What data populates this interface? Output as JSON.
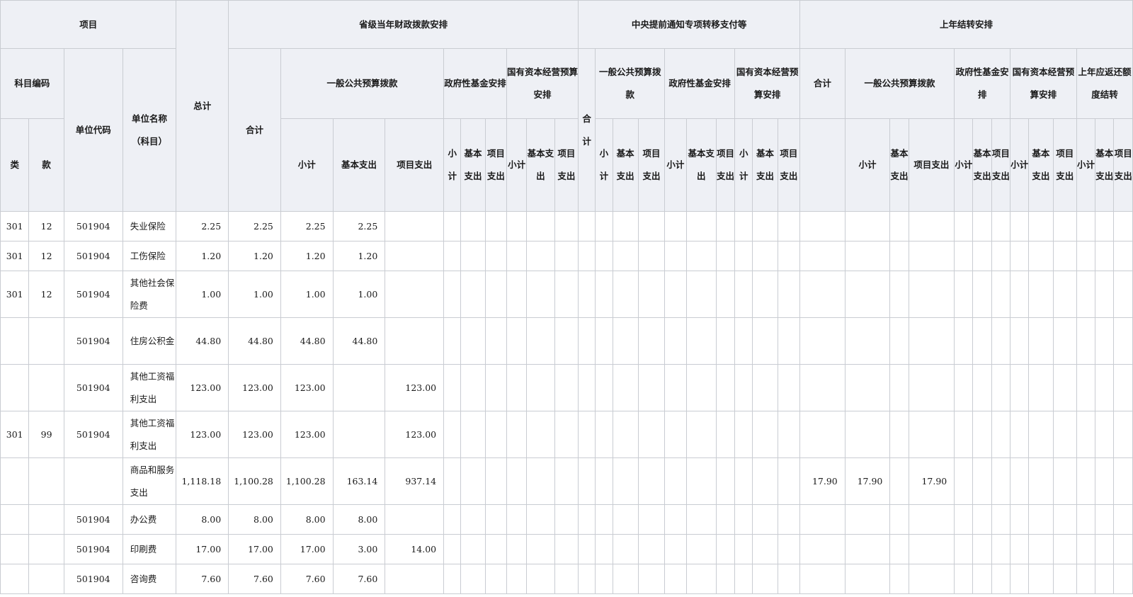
{
  "header": {
    "project": "项目",
    "subject_code": "科目编码",
    "category": "类",
    "section": "款",
    "unit_code": "单位代码",
    "unit_name": "单位名称（科目）",
    "grand_total": "总计",
    "provincial": "省级当年财政拨款安排",
    "central": "中央提前通知专项转移支付等",
    "carryover": "上年结转安排",
    "total": "合计",
    "general_budget": "一般公共预算拨款",
    "gov_fund": "政府性基金安排",
    "state_capital": "国有资本经营预算安排",
    "general_budget_central": "一般公共预算拨款",
    "gov_fund_central": "政府性基金安排",
    "state_capital_central": "国有资本经营预算安排",
    "total_carry": "合计",
    "general_budget_carry": "一般公共预算拨款",
    "gov_fund_carry": "政府性基金安排",
    "state_capital_carry": "国有资本经营预算安排",
    "prev_refund": "上年应返还额度结转",
    "subtotal": "小计",
    "basic": "基本支出",
    "project_exp": "项目支出"
  },
  "rows": [
    {
      "cat": "301",
      "sec": "12",
      "unit": "501904",
      "name": "失业保险",
      "total": "2.25",
      "p_total": "2.25",
      "p_sub": "2.25",
      "p_basic": "2.25",
      "p_proj": "",
      "c_total": "",
      "c_sub": "",
      "c_proj": ""
    },
    {
      "cat": "301",
      "sec": "12",
      "unit": "501904",
      "name": "工伤保险",
      "total": "1.20",
      "p_total": "1.20",
      "p_sub": "1.20",
      "p_basic": "1.20",
      "p_proj": "",
      "c_total": "",
      "c_sub": "",
      "c_proj": ""
    },
    {
      "cat": "301",
      "sec": "12",
      "unit": "501904",
      "name": "其他社会保险费",
      "total": "1.00",
      "p_total": "1.00",
      "p_sub": "1.00",
      "p_basic": "1.00",
      "p_proj": "",
      "c_total": "",
      "c_sub": "",
      "c_proj": ""
    },
    {
      "cat": "",
      "sec": "",
      "unit": "501904",
      "name": "住房公积金",
      "total": "44.80",
      "p_total": "44.80",
      "p_sub": "44.80",
      "p_basic": "44.80",
      "p_proj": "",
      "c_total": "",
      "c_sub": "",
      "c_proj": ""
    },
    {
      "cat": "",
      "sec": "",
      "unit": "501904",
      "name": "其他工资福利支出",
      "total": "123.00",
      "p_total": "123.00",
      "p_sub": "123.00",
      "p_basic": "",
      "p_proj": "123.00",
      "c_total": "",
      "c_sub": "",
      "c_proj": ""
    },
    {
      "cat": "301",
      "sec": "99",
      "unit": "501904",
      "name": "其他工资福利支出",
      "total": "123.00",
      "p_total": "123.00",
      "p_sub": "123.00",
      "p_basic": "",
      "p_proj": "123.00",
      "c_total": "",
      "c_sub": "",
      "c_proj": ""
    },
    {
      "cat": "",
      "sec": "",
      "unit": "",
      "name": "商品和服务支出",
      "total": "1,118.18",
      "p_total": "1,100.28",
      "p_sub": "1,100.28",
      "p_basic": "163.14",
      "p_proj": "937.14",
      "c_total": "17.90",
      "c_sub": "17.90",
      "c_proj": "17.90"
    },
    {
      "cat": "",
      "sec": "",
      "unit": "501904",
      "name": "办公费",
      "total": "8.00",
      "p_total": "8.00",
      "p_sub": "8.00",
      "p_basic": "8.00",
      "p_proj": "",
      "c_total": "",
      "c_sub": "",
      "c_proj": ""
    },
    {
      "cat": "",
      "sec": "",
      "unit": "501904",
      "name": "印刷费",
      "total": "17.00",
      "p_total": "17.00",
      "p_sub": "17.00",
      "p_basic": "3.00",
      "p_proj": "14.00",
      "c_total": "",
      "c_sub": "",
      "c_proj": ""
    },
    {
      "cat": "",
      "sec": "",
      "unit": "501904",
      "name": "咨询费",
      "total": "7.60",
      "p_total": "7.60",
      "p_sub": "7.60",
      "p_basic": "7.60",
      "p_proj": "",
      "c_total": "",
      "c_sub": "",
      "c_proj": ""
    }
  ]
}
